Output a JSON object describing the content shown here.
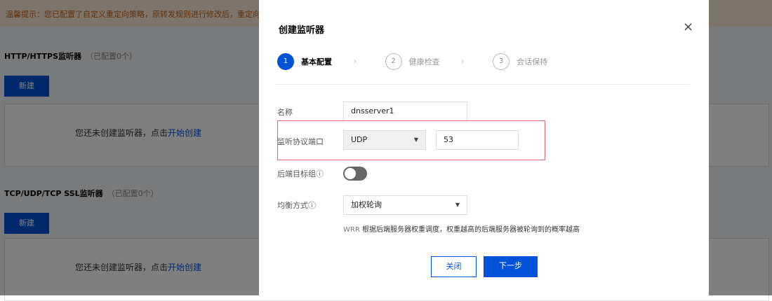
{
  "background": {
    "notice": "温馨提示：您已配置了自定义重定向策略，原转发规则进行修改后，重定向配置将会失效",
    "http_section": {
      "title": "HTTP/HTTPS监听器",
      "count": "（已配置0个）",
      "new_label": "新建",
      "empty_text": "您还未创建监听器，点击",
      "empty_link": "开始创建"
    },
    "tcp_section": {
      "title": "TCP/UDP/TCP SSL监听器",
      "count": "（已配置0个）",
      "new_label": "新建",
      "empty_text": "您还未创建监听器，点击",
      "empty_link": "开始创建"
    }
  },
  "modal": {
    "title": "创建监听器",
    "close_icon": "×",
    "steps": [
      {
        "num": "1",
        "label": "基本配置"
      },
      {
        "num": "2",
        "label": "健康检查"
      },
      {
        "num": "3",
        "label": "会话保持"
      }
    ],
    "form": {
      "name_label": "名称",
      "name_value": "dnsserver1",
      "protocol_label": "监听协议端口",
      "protocol_value": "UDP",
      "port_value": "53",
      "target_group_label": "后端目标组",
      "target_group_enabled": false,
      "balance_label": "均衡方式",
      "balance_value": "加权轮询",
      "help_prefix": "WRR",
      "help_text": "根据后端服务器权重调度，权重越高的后端服务器被轮询到的概率越高"
    },
    "buttons": {
      "close": "关闭",
      "next": "下一步"
    }
  }
}
